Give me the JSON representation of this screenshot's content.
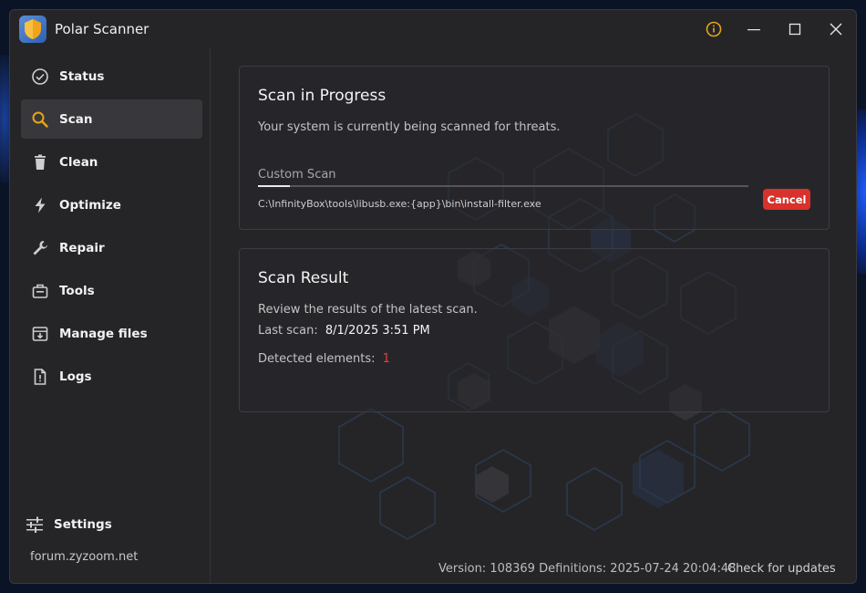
{
  "app": {
    "title": "Polar Scanner",
    "logo_icon": "shield-icon"
  },
  "titlebar": {
    "info_icon": "info-icon",
    "minimize_icon": "minimize-icon",
    "maximize_icon": "maximize-icon",
    "close_icon": "close-icon",
    "info_color": "#e8a317"
  },
  "sidebar": {
    "items": [
      {
        "label": "Status",
        "icon": "check-circle-icon",
        "active": false
      },
      {
        "label": "Scan",
        "icon": "search-icon",
        "active": true
      },
      {
        "label": "Clean",
        "icon": "trash-icon",
        "active": false
      },
      {
        "label": "Optimize",
        "icon": "lightning-icon",
        "active": false
      },
      {
        "label": "Repair",
        "icon": "wrench-icon",
        "active": false
      },
      {
        "label": "Tools",
        "icon": "toolbox-icon",
        "active": false
      },
      {
        "label": "Manage files",
        "icon": "file-box-icon",
        "active": false
      },
      {
        "label": "Logs",
        "icon": "log-file-icon",
        "active": false
      }
    ],
    "settings_label": "Settings",
    "forum_link": "forum.zyzoom.net"
  },
  "scan_progress": {
    "title": "Scan in Progress",
    "description": "Your system is currently being scanned for threats.",
    "scan_type": "Custom Scan",
    "progress_fraction": 0.065,
    "current_path": "C:\\InfinityBox\\tools\\libusb.exe:{app}\\bin\\install-filter.exe",
    "cancel_label": "Cancel"
  },
  "scan_result": {
    "title": "Scan Result",
    "description": "Review the results of the latest scan.",
    "last_scan_label": "Last scan:",
    "last_scan_value": "8/1/2025 3:51 PM",
    "detected_label": "Detected elements:",
    "detected_value": "1"
  },
  "footer": {
    "version_text": "Version: 108369 Definitions: 2025-07-24 20:04:48",
    "check_updates": "Check for updates"
  },
  "colors": {
    "accent": "#e8a317",
    "danger": "#d9312b",
    "background": "#252528"
  }
}
